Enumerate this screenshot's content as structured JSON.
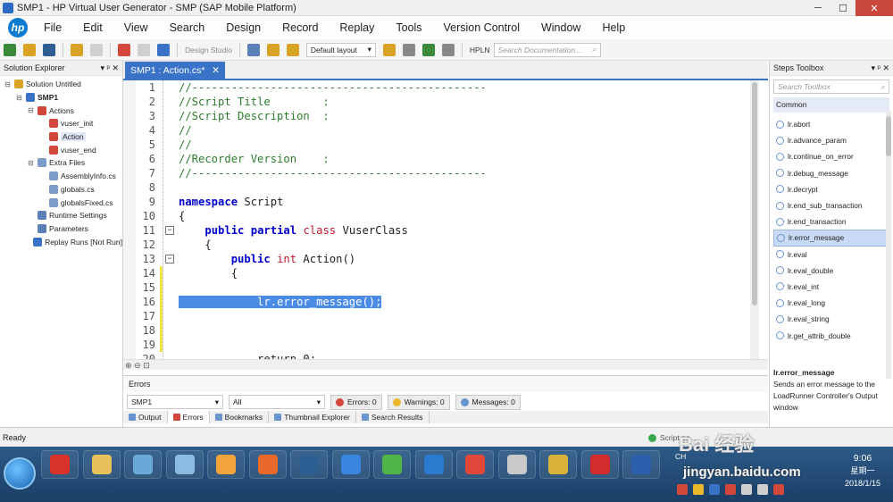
{
  "window": {
    "title": "SMP1 - HP Virtual User Generator - SMP (SAP Mobile Platform)",
    "min": "─",
    "max": "☐",
    "close": "✕"
  },
  "logo": "hp",
  "menu": [
    "File",
    "Edit",
    "View",
    "Search",
    "Design",
    "Record",
    "Replay",
    "Tools",
    "Version Control",
    "Window",
    "Help"
  ],
  "toolbar": {
    "design_studio": "Design Studio",
    "layout": "Default layout",
    "hpln": "HPLN",
    "search_placeholder": "Search Documentation...",
    "dropdown": "▾",
    "search_icon": "⌕"
  },
  "solution_explorer": {
    "title": "Solution Explorer",
    "pin": "▾ ᵖ ✕",
    "items": [
      {
        "label": "Solution Untitled",
        "indent": 0,
        "exp": "⊟",
        "color": "#d9a425"
      },
      {
        "label": "SMP1",
        "indent": 1,
        "exp": "⊟",
        "color": "#3a72c8",
        "bold": true
      },
      {
        "label": "Actions",
        "indent": 2,
        "exp": "⊟",
        "color": "#d2463c"
      },
      {
        "label": "vuser_init",
        "indent": 3,
        "exp": "",
        "color": "#d2463c"
      },
      {
        "label": "Action",
        "indent": 3,
        "exp": "",
        "color": "#d2463c",
        "selected": true
      },
      {
        "label": "vuser_end",
        "indent": 3,
        "exp": "",
        "color": "#d2463c"
      },
      {
        "label": "Extra Files",
        "indent": 2,
        "exp": "⊟",
        "color": "#7a9cc9"
      },
      {
        "label": "AssemblyInfo.cs",
        "indent": 3,
        "exp": "",
        "color": "#7a9cc9"
      },
      {
        "label": "globals.cs",
        "indent": 3,
        "exp": "",
        "color": "#7a9cc9"
      },
      {
        "label": "globalsFixed.cs",
        "indent": 3,
        "exp": "",
        "color": "#7a9cc9"
      },
      {
        "label": "Runtime Settings",
        "indent": 2,
        "exp": "",
        "color": "#5b7fb8"
      },
      {
        "label": "Parameters",
        "indent": 2,
        "exp": "",
        "color": "#5b7fb8"
      },
      {
        "label": "Replay Runs [Not Run]",
        "indent": 2,
        "exp": "",
        "color": "#3a72c8"
      }
    ]
  },
  "editor": {
    "tab_label": "SMP1 : Action.cs*",
    "tab_close": "✕",
    "line_numbers": [
      "1",
      "2",
      "3",
      "4",
      "5",
      "6",
      "7",
      "8",
      "9",
      "10",
      "11",
      "12",
      "13",
      "14",
      "15",
      "16",
      "17",
      "18",
      "19",
      "20"
    ],
    "lines": [
      [
        {
          "t": "//---------------------------------------------",
          "c": "cm"
        }
      ],
      [
        {
          "t": "//Script Title        :",
          "c": "cm"
        }
      ],
      [
        {
          "t": "//Script Description  :",
          "c": "cm"
        }
      ],
      [
        {
          "t": "//",
          "c": "cm"
        }
      ],
      [
        {
          "t": "//",
          "c": "cm"
        }
      ],
      [
        {
          "t": "//Recorder Version    :",
          "c": "cm"
        }
      ],
      [
        {
          "t": "//---------------------------------------------",
          "c": "cm"
        }
      ],
      [
        {
          "t": "",
          "c": ""
        }
      ],
      [
        {
          "t": "namespace",
          "c": "kw"
        },
        {
          "t": " Script",
          "c": ""
        }
      ],
      [
        {
          "t": "{",
          "c": ""
        }
      ],
      [
        {
          "t": "    ",
          "c": ""
        },
        {
          "t": "public",
          "c": "kw"
        },
        {
          "t": " ",
          "c": ""
        },
        {
          "t": "partial",
          "c": "kw"
        },
        {
          "t": " ",
          "c": ""
        },
        {
          "t": "class",
          "c": "ty"
        },
        {
          "t": " VuserClass",
          "c": ""
        }
      ],
      [
        {
          "t": "    {",
          "c": ""
        }
      ],
      [
        {
          "t": "        ",
          "c": ""
        },
        {
          "t": "public",
          "c": "kw"
        },
        {
          "t": " ",
          "c": ""
        },
        {
          "t": "int",
          "c": "ty"
        },
        {
          "t": " Action()",
          "c": ""
        }
      ],
      [
        {
          "t": "        {",
          "c": ""
        }
      ],
      [
        {
          "t": "",
          "c": ""
        }
      ],
      [
        {
          "t": "            lr.error_message();",
          "c": "hl"
        }
      ],
      [
        {
          "t": "",
          "c": ""
        }
      ],
      [
        {
          "t": "",
          "c": ""
        }
      ],
      [
        {
          "t": "",
          "c": ""
        }
      ],
      [
        {
          "t": "            return 0;",
          "c": ""
        }
      ]
    ]
  },
  "errors_panel": {
    "title": "Errors",
    "project": "SMP1",
    "filter": "All",
    "errors": "Errors: 0",
    "warnings": "Warnings: 0",
    "messages": "Messages: 0"
  },
  "bottom_tabs": [
    "Output",
    "Errors",
    "Bookmarks",
    "Thumbnail Explorer",
    "Search Results"
  ],
  "steps_toolbox": {
    "title": "Steps Toolbox",
    "search_placeholder": "Search Toolbox",
    "group": "Common",
    "steps": [
      "lr.abort",
      "lr.advance_param",
      "lr.continue_on_error",
      "lr.debug_message",
      "lr.decrypt",
      "lr.end_sub_transaction",
      "lr.end_transaction",
      "lr.error_message",
      "lr.eval",
      "lr.eval_double",
      "lr.eval_int",
      "lr.eval_long",
      "lr.eval_string",
      "lr.get_attrib_double"
    ],
    "selected": "lr.error_message",
    "desc_title": "lr.error_message",
    "desc_text": "Sends an error message to the LoadRunner Controller's Output window"
  },
  "status": {
    "left": "Ready",
    "right": "Script pa..."
  },
  "taskbar": {
    "apps": [
      {
        "color": "#d8332b"
      },
      {
        "color": "#e9c15a"
      },
      {
        "color": "#6aa8d8"
      },
      {
        "color": "#8bbbe0"
      },
      {
        "color": "#f2a33a"
      },
      {
        "color": "#e8692a"
      },
      {
        "color": "#2d5f93"
      },
      {
        "color": "#3a85e0"
      },
      {
        "color": "#4fb548"
      },
      {
        "color": "#2a7bd0"
      },
      {
        "color": "#e0483a"
      },
      {
        "color": "#c9c9c9"
      },
      {
        "color": "#d9b23a"
      },
      {
        "color": "#d32c2c"
      },
      {
        "color": "#2b5fae"
      }
    ],
    "tray_label": "CH",
    "time": "9:06",
    "weekday": "星期一",
    "date": "2018/1/15"
  },
  "watermark": {
    "top": "Bai 经验",
    "bottom": "jingyan.baidu.com"
  }
}
